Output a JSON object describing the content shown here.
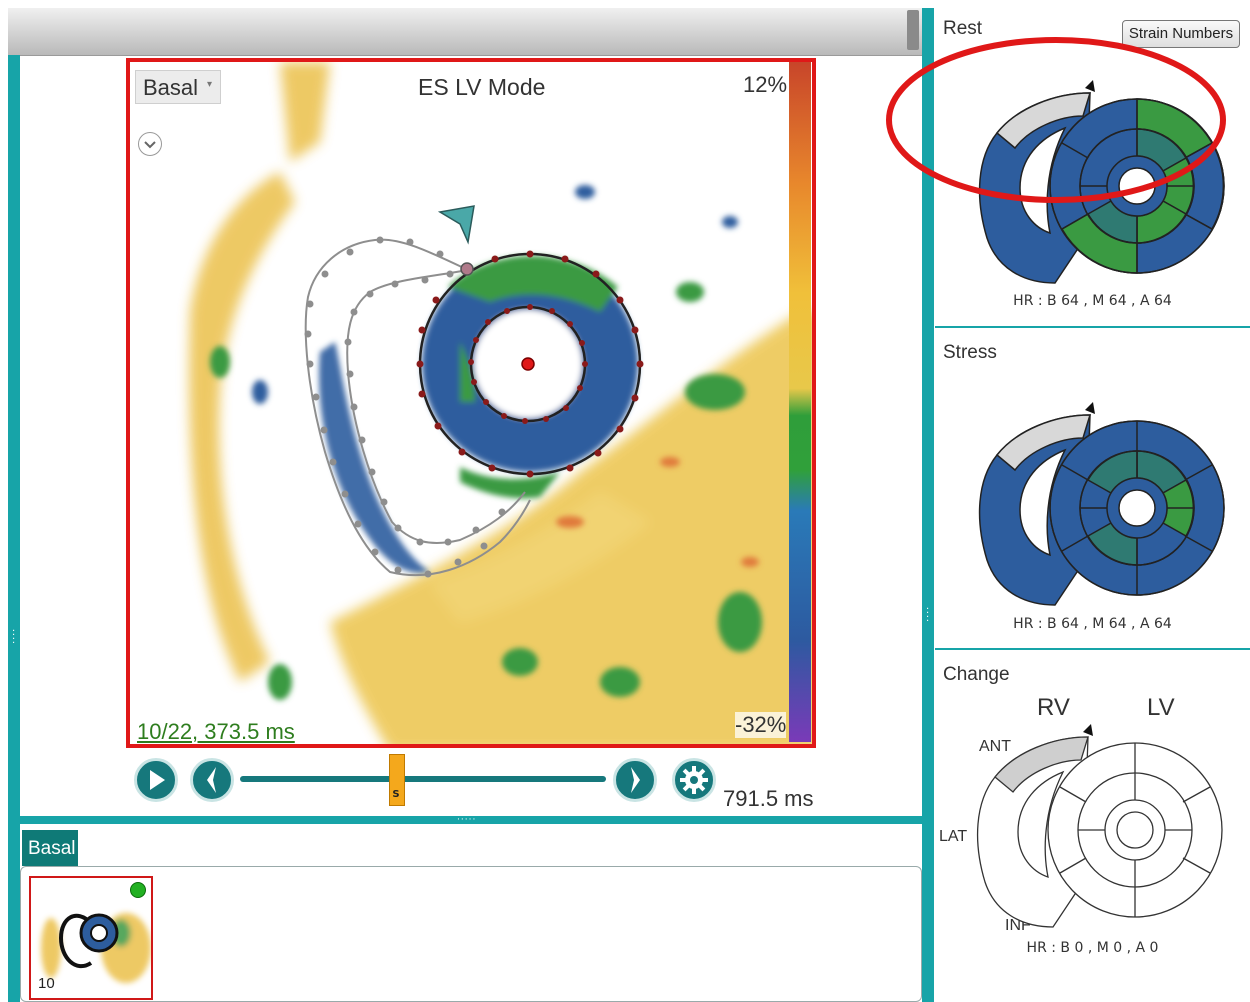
{
  "viewer": {
    "view_select": "Basal",
    "mode_title": "ES LV Mode",
    "scale_max": "12%",
    "scale_min": "-32%",
    "frame_time": "10/22, 373.5 ms"
  },
  "playback": {
    "thumb_label": "S",
    "duration": "791.5 ms",
    "position_fraction": 0.43
  },
  "series": {
    "tab_label": "Basal",
    "thumbnail_index": "10"
  },
  "rest": {
    "title": "Rest",
    "strain_numbers_button": "Strain Numbers",
    "hr": "HR : B  64 , M  64 , A  64"
  },
  "stress": {
    "title": "Stress",
    "hr": "HR : B  64 , M  64 , A  64"
  },
  "change": {
    "title": "Change",
    "rv_label": "RV",
    "lv_label": "LV",
    "ant_label": "ANT",
    "lat_label": "LAT",
    "inf_label": "INF",
    "hr": "HR : B  0 , M  0 , A  0"
  },
  "colors": {
    "accent_teal": "#17a4a8",
    "viewer_border": "#e01818",
    "strain_blue": "#2d5d9e",
    "strain_green": "#3a9a42",
    "slider_thumb": "#f4a81c"
  }
}
